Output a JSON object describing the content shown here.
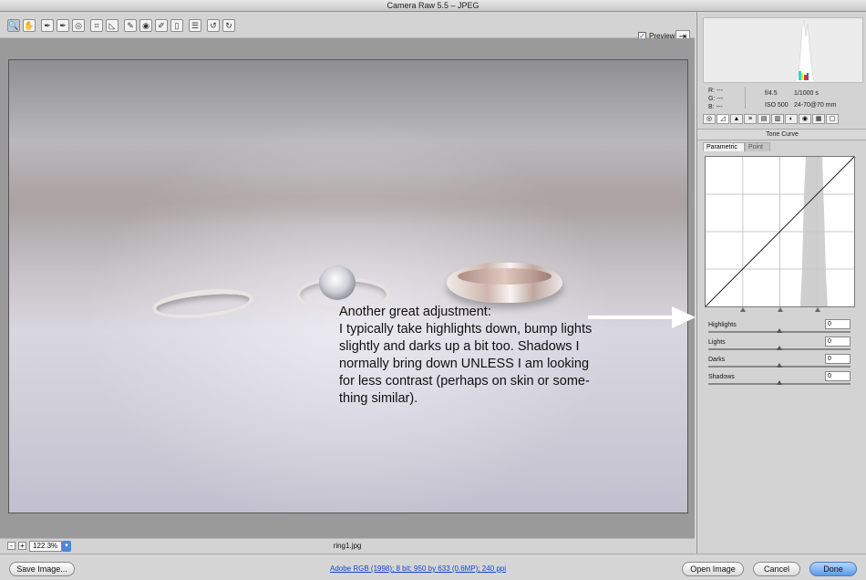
{
  "window": {
    "title": "Camera Raw 5.5  –  JPEG"
  },
  "toolbar": {
    "tools": [
      {
        "name": "zoom-tool",
        "icon": "magnifier",
        "glyph": "🔍"
      },
      {
        "name": "hand-tool",
        "icon": "hand",
        "glyph": "✋"
      },
      {
        "name": "white-balance-tool",
        "icon": "eyedropper",
        "glyph": "✒"
      },
      {
        "name": "color-sampler-tool",
        "icon": "eyedropper-target",
        "glyph": "✒"
      },
      {
        "name": "targeted-adjustment-tool",
        "icon": "target",
        "glyph": "◎"
      },
      {
        "name": "crop-tool",
        "icon": "crop",
        "glyph": "⌗"
      },
      {
        "name": "straighten-tool",
        "icon": "straighten",
        "glyph": "◺"
      },
      {
        "name": "spot-removal-tool",
        "icon": "brush-spot",
        "glyph": "✎"
      },
      {
        "name": "red-eye-tool",
        "icon": "eye",
        "glyph": "◉"
      },
      {
        "name": "adjustment-brush-tool",
        "icon": "brush",
        "glyph": "✐"
      },
      {
        "name": "graduated-filter-tool",
        "icon": "gradient",
        "glyph": "▯"
      },
      {
        "name": "preferences-tool",
        "icon": "list",
        "glyph": "☰"
      },
      {
        "name": "rotate-left-tool",
        "icon": "rotate-ccw",
        "glyph": "↺"
      },
      {
        "name": "rotate-right-tool",
        "icon": "rotate-cw",
        "glyph": "↻"
      }
    ],
    "preview_label": "Preview",
    "preview_checked": "✓"
  },
  "annotation": {
    "text": "Another great adjustment:\nI typically take highlights down, bump lights\nslightly and darks up a bit too.  Shadows I\nnormally bring down UNLESS I am looking\nfor  less contrast (perhaps on skin or some-\nthing similar)."
  },
  "status": {
    "zoom_out": "-",
    "zoom_in": "+",
    "zoom_value": "122.3%",
    "filename": "ring1.jpg"
  },
  "info": {
    "r_label": "R:",
    "r_value": "---",
    "g_label": "G:",
    "g_value": "---",
    "b_label": "B:",
    "b_value": "---",
    "aperture": "f/4.5",
    "shutter": "1/1000 s",
    "iso": "ISO 500",
    "lens": "24-70@70 mm"
  },
  "panel": {
    "section_title": "Tone Curve",
    "tab_parametric": "Parametric",
    "tab_point": "Point",
    "sliders": [
      {
        "label": "Highlights",
        "value": "0",
        "level": 0.5
      },
      {
        "label": "Lights",
        "value": "0",
        "level": 0.5
      },
      {
        "label": "Darks",
        "value": "0",
        "level": 0.5
      },
      {
        "label": "Shadows",
        "value": "0",
        "level": 0.5
      }
    ]
  },
  "bottom": {
    "save_label": "Save Image...",
    "workflow": "Adobe RGB (1998); 8 bit; 950 by 633 (0.6MP); 240 ppi",
    "open_label": "Open Image",
    "cancel_label": "Cancel",
    "done_label": "Done"
  },
  "colors": {
    "accent": "#4d86d9",
    "link": "#1b3fd0",
    "background": "#d6d6d6"
  }
}
